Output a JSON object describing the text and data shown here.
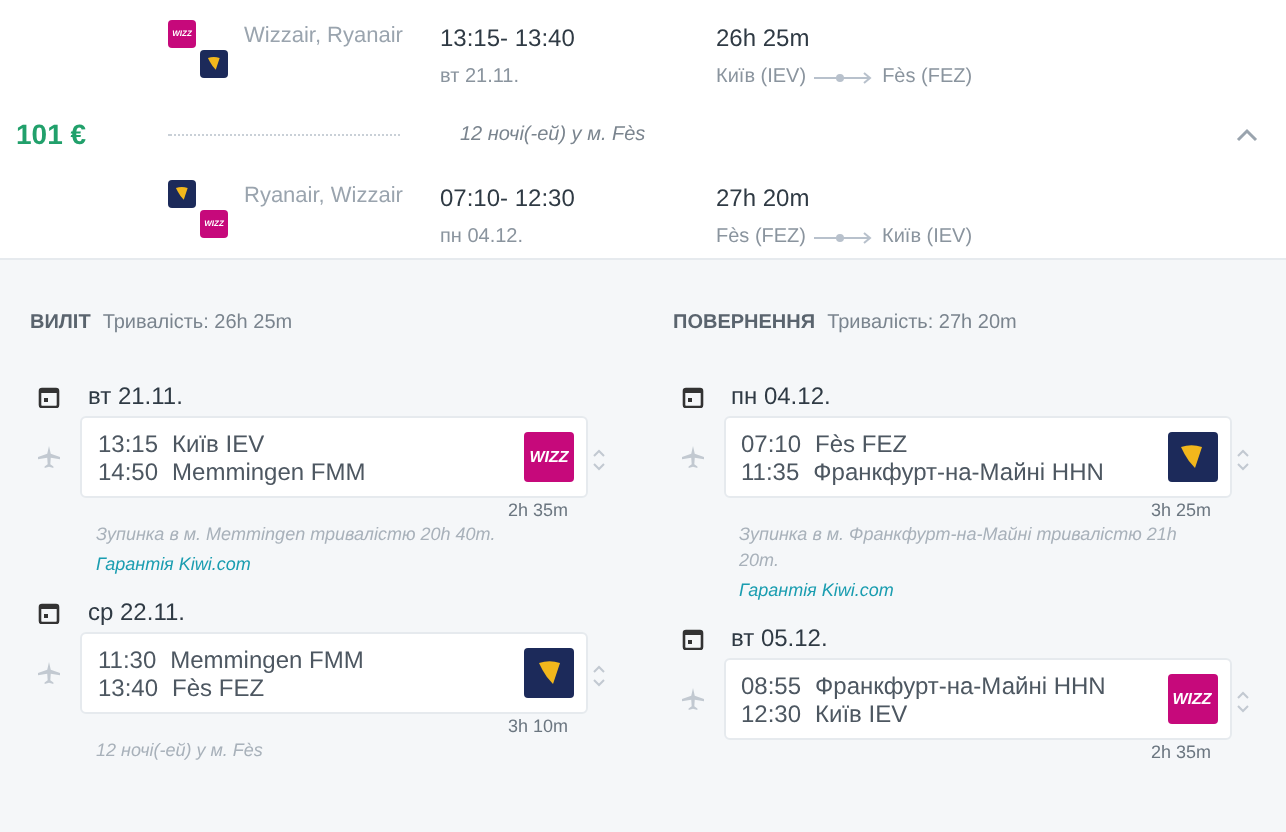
{
  "summary": {
    "price": "101 €",
    "expanded": true,
    "legs": [
      {
        "logos": [
          {
            "kind": "wizz",
            "text": "WIZZ"
          },
          {
            "kind": "ryanair"
          }
        ],
        "airlines": "Wizzair, Ryanair",
        "times": "13:15- 13:40",
        "date": "вт 21.11.",
        "duration": "26h 25m",
        "from": "Київ (IEV)",
        "to": "Fès (FEZ)"
      },
      {
        "logos": [
          {
            "kind": "ryanair"
          },
          {
            "kind": "wizz",
            "text": "WIZZ"
          }
        ],
        "airlines": "Ryanair, Wizzair",
        "times": "07:10- 12:30",
        "date": "пн 04.12.",
        "duration": "27h 20m",
        "from": "Fès (FEZ)",
        "to": "Київ (IEV)"
      }
    ],
    "nights": "12 ночі(-ей) у м. Fès"
  },
  "sections": [
    {
      "title": "ВИЛІТ",
      "duration": "Тривалість: 26h 25m",
      "items": [
        {
          "kind": "date",
          "text": "вт 21.11."
        },
        {
          "kind": "segment",
          "dep_time": "13:15",
          "dep_place": "Київ IEV",
          "arr_time": "14:50",
          "arr_place": "Memmingen FMM",
          "logo": {
            "kind": "wizz",
            "text": "WIZZ"
          },
          "flight_time": "2h 35m"
        },
        {
          "kind": "stop",
          "text": "Зупинка в м. Memmingen тривалістю 20h 40m.",
          "link": "Гарантія Kiwi.com"
        },
        {
          "kind": "date",
          "text": "ср 22.11."
        },
        {
          "kind": "segment",
          "dep_time": "11:30",
          "dep_place": "Memmingen FMM",
          "arr_time": "13:40",
          "arr_place": "Fès FEZ",
          "logo": {
            "kind": "ryanair"
          },
          "flight_time": "3h 10m"
        },
        {
          "kind": "nights",
          "text": "12 ночі(-ей) у м. Fès"
        }
      ]
    },
    {
      "title": "ПОВЕРНЕННЯ",
      "duration": "Тривалість: 27h 20m",
      "items": [
        {
          "kind": "date",
          "text": "пн 04.12."
        },
        {
          "kind": "segment",
          "dep_time": "07:10",
          "dep_place": "Fès FEZ",
          "arr_time": "11:35",
          "arr_place": "Франкфурт-на-Майні HHN",
          "logo": {
            "kind": "ryanair"
          },
          "flight_time": "3h 25m"
        },
        {
          "kind": "stop",
          "text": "Зупинка в м. Франкфурт-на-Майні тривалістю 21h 20m.",
          "link": "Гарантія Kiwi.com"
        },
        {
          "kind": "date",
          "text": "вт 05.12."
        },
        {
          "kind": "segment",
          "dep_time": "08:55",
          "dep_place": "Франкфурт-на-Майні HHN",
          "arr_time": "12:30",
          "arr_place": "Київ IEV",
          "logo": {
            "kind": "wizz",
            "text": "WIZZ"
          },
          "flight_time": "2h 35m"
        }
      ]
    }
  ]
}
